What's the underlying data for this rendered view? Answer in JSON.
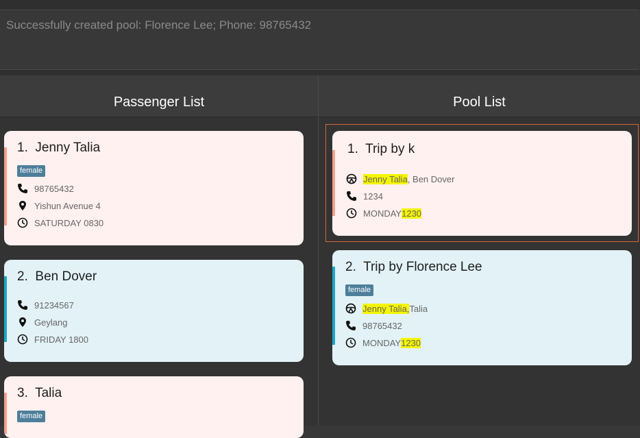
{
  "result": {
    "text": "Successfully created pool: Florence Lee; Phone: 98765432"
  },
  "passenger_panel": {
    "title": "Passenger List",
    "passengers": [
      {
        "index": "1.",
        "name": "Jenny Talia",
        "tag": "female",
        "phone": "98765432",
        "address": "Yishun Avenue 4",
        "time": "SATURDAY 0830"
      },
      {
        "index": "2.",
        "name": "Ben Dover",
        "phone": "91234567",
        "address": "Geylang",
        "time": "FRIDAY 1800"
      },
      {
        "index": "3.",
        "name": "Talia",
        "tag": "female"
      }
    ]
  },
  "pool_panel": {
    "title": "Pool List",
    "pools": [
      {
        "index": "1.",
        "title": "Trip by k",
        "passengers_hl": "Jenny Talia",
        "passengers_rest": ", Ben Dover",
        "phone": "1234",
        "time_prefix": "MONDAY ",
        "time_hl": "1230"
      },
      {
        "index": "2.",
        "title": "Trip by Florence Lee",
        "tag": "female",
        "passengers_hl": "Jenny Talia,",
        "passengers_rest": " Talia",
        "phone": "98765432",
        "time_prefix": "MONDAY ",
        "time_hl": "1230"
      }
    ]
  },
  "colors": {
    "pink_card": "#fff1f0",
    "blue_card": "#e2f2f7",
    "pink_stripe": "#f2a08e",
    "blue_stripe": "#1fa5c8",
    "tag": "#4e7f9a",
    "highlight": "#f5f500",
    "selection": "#d9663a"
  },
  "icons": {
    "phone": "phone-icon",
    "location": "location-pin-icon",
    "time": "clock-icon",
    "driver": "steering-wheel-icon"
  }
}
